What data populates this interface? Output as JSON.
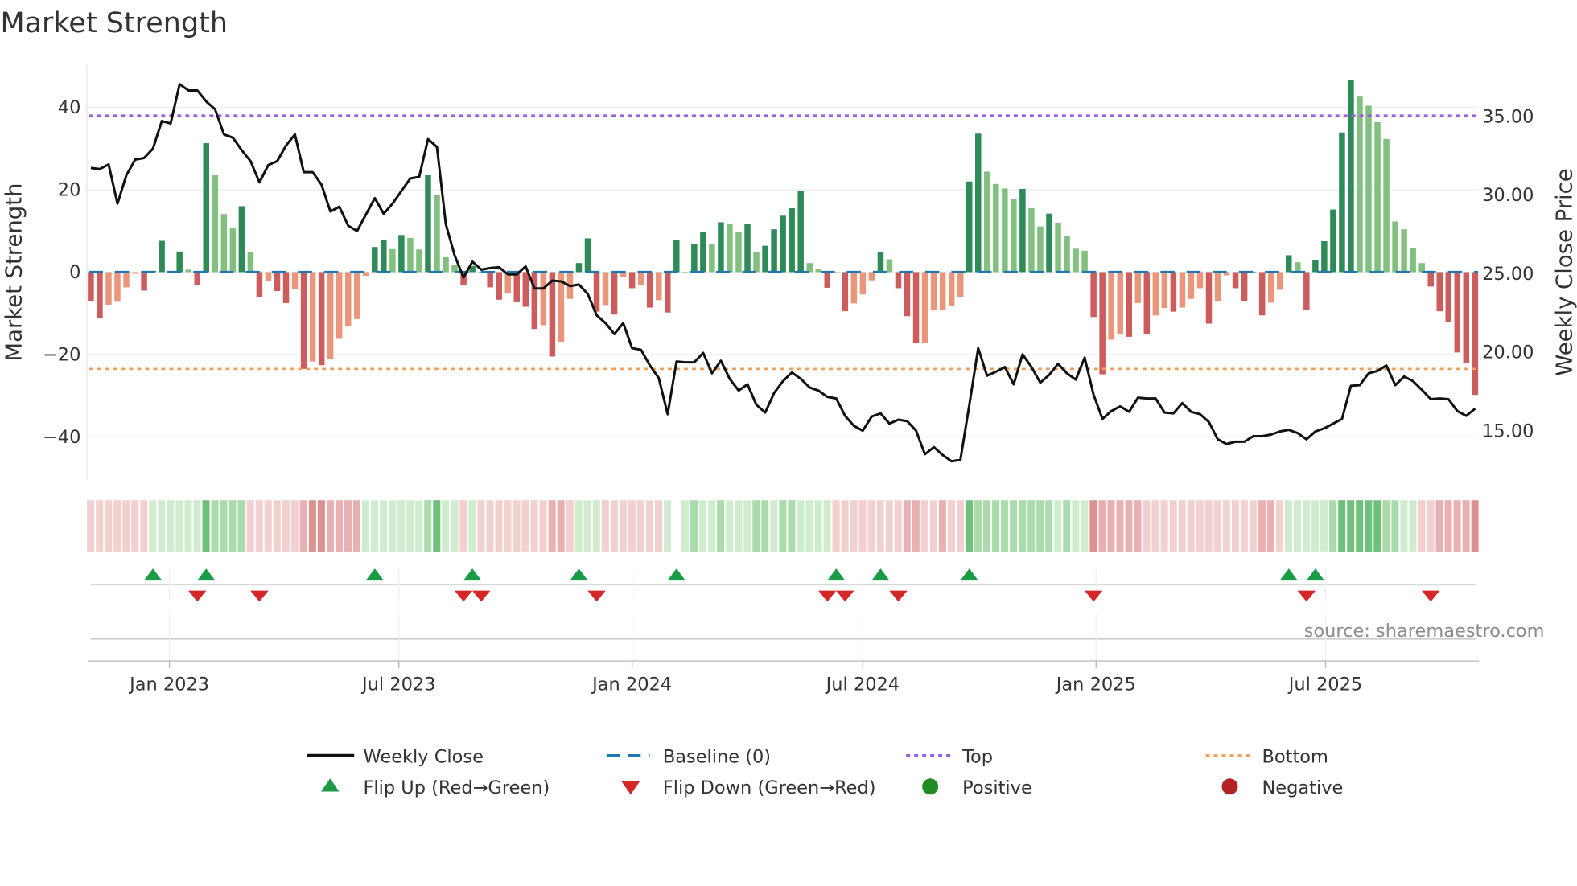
{
  "title": "Market Strength",
  "source": "source: sharemaestro.com",
  "colors": {
    "pos_strong": "#2e8b57",
    "pos_weak": "#81c07f",
    "neg_strong": "#cd5c5c",
    "neg_weak": "#e9967a",
    "close": "#111111",
    "baseline": "#1f77b4",
    "top": "#9c5de0",
    "bottom": "#f0a05a",
    "flip_up": "#1a9c46",
    "flip_down": "#d62728",
    "positive": "#228b22",
    "negative": "#b22222",
    "strip_green": [
      "#cfeccf",
      "#a9dcaa",
      "#6fc07a"
    ],
    "strip_red": [
      "#f2d0d0",
      "#e8b0b0",
      "#dc9090"
    ]
  },
  "legend": {
    "weekly_close": "Weekly Close",
    "baseline": "Baseline (0)",
    "top": "Top",
    "bottom": "Bottom",
    "flip_up": "Flip Up (Red→Green)",
    "flip_down": "Flip Down (Green→Red)",
    "positive": "Positive",
    "negative": "Negative"
  },
  "chart_data": {
    "type": "bar",
    "title": "Market Strength",
    "ylabel": "Market Strength",
    "y2label": "Weekly Close Price",
    "start_week": "2022-10-31",
    "ylim": [
      -50.5,
      50.2
    ],
    "y2lim": [
      11.8,
      38.2
    ],
    "yticks": [
      {
        "v": 40,
        "label": "40"
      },
      {
        "v": 20,
        "label": "20"
      },
      {
        "v": 0,
        "label": "0"
      },
      {
        "v": -20,
        "label": "−20"
      },
      {
        "v": -40,
        "label": "−40"
      }
    ],
    "y2ticks": [
      {
        "v": 35,
        "label": "35.00"
      },
      {
        "v": 30,
        "label": "30.00"
      },
      {
        "v": 25,
        "label": "25.00"
      },
      {
        "v": 20,
        "label": "20.00"
      },
      {
        "v": 15,
        "label": "15.00"
      }
    ],
    "xticks": [
      {
        "date": "2023-01-01",
        "label": "Jan 2023"
      },
      {
        "date": "2023-07-01",
        "label": "Jul 2023"
      },
      {
        "date": "2024-01-01",
        "label": "Jan 2024"
      },
      {
        "date": "2024-07-01",
        "label": "Jul 2024"
      },
      {
        "date": "2025-01-01",
        "label": "Jan 2025"
      },
      {
        "date": "2025-07-01",
        "label": "Jul 2025"
      }
    ],
    "top_level": 38,
    "bottom_level": -23.5,
    "baseline": 0,
    "strength": [
      -7.0,
      -11.1,
      -7.9,
      -7.2,
      -3.7,
      -0.4,
      -4.5,
      0.3,
      7.6,
      0.2,
      5.0,
      0.6,
      -3.2,
      31.3,
      23.5,
      14.1,
      10.6,
      16.0,
      4.9,
      -6.0,
      -2.1,
      -4.6,
      -7.5,
      -4.2,
      -23.5,
      -21.7,
      -22.6,
      -21.0,
      -16.2,
      -13.1,
      -11.4,
      -0.9,
      6.1,
      7.7,
      5.6,
      9.0,
      8.3,
      5.5,
      23.5,
      18.8,
      3.6,
      1.7,
      -3.1,
      1.5,
      0.1,
      -3.7,
      -6.7,
      -5.2,
      -7.3,
      -8.4,
      -13.8,
      -12.9,
      -20.5,
      -16.9,
      -6.5,
      2.2,
      8.2,
      -9.6,
      -8.0,
      -10.3,
      -1.3,
      -3.9,
      -3.2,
      -8.6,
      -6.8,
      -9.8,
      7.9,
      0.1,
      6.8,
      9.8,
      6.7,
      12.1,
      11.6,
      9.7,
      11.6,
      4.9,
      6.4,
      10.4,
      13.7,
      15.5,
      19.7,
      2.2,
      0.8,
      -3.8,
      -0.1,
      -9.5,
      -7.6,
      -5.4,
      -2.0,
      4.9,
      3.1,
      -3.9,
      -10.7,
      -17.1,
      -17.1,
      -9.3,
      -9.3,
      -8.2,
      -6.0,
      22.0,
      33.6,
      24.4,
      21.4,
      20.3,
      17.7,
      20.2,
      15.5,
      11.1,
      14.2,
      12.0,
      8.8,
      5.7,
      5.2,
      -10.9,
      -24.8,
      -16.4,
      -15.0,
      -15.7,
      -7.5,
      -15.1,
      -10.5,
      -8.7,
      -9.6,
      -8.6,
      -6.5,
      -3.9,
      -12.5,
      -7.0,
      -0.8,
      -3.9,
      -7.0,
      0,
      -10.5,
      -7.4,
      -4.3,
      4.1,
      2.4,
      -9.1,
      2.9,
      7.5,
      15.2,
      33.9,
      46.7,
      42.6,
      40.4,
      36.4,
      32.3,
      12.3,
      10.4,
      5.9,
      2.2,
      -3.5,
      -9.5,
      -12.1,
      -19.5,
      -22.0,
      -29.8
    ],
    "close": [
      31.67,
      31.6,
      31.9,
      29.4,
      31.2,
      32.2,
      32.3,
      32.9,
      34.65,
      34.5,
      37.0,
      36.6,
      36.6,
      35.9,
      35.4,
      33.8,
      33.6,
      32.8,
      32.1,
      30.75,
      31.85,
      32.1,
      33.1,
      33.8,
      31.4,
      31.4,
      30.6,
      28.9,
      29.2,
      28.0,
      27.65,
      28.7,
      29.75,
      28.75,
      29.4,
      30.2,
      31.0,
      31.1,
      33.5,
      33.0,
      28.1,
      26.1,
      24.7,
      25.7,
      25.2,
      25.3,
      25.35,
      24.9,
      24.9,
      25.4,
      24.0,
      24.0,
      24.5,
      24.45,
      24.15,
      24.25,
      23.65,
      22.3,
      21.8,
      21.1,
      21.8,
      20.2,
      20.1,
      19.1,
      18.3,
      16.0,
      19.35,
      19.3,
      19.3,
      19.9,
      18.6,
      19.4,
      18.25,
      17.5,
      17.9,
      16.6,
      16.1,
      17.35,
      18.1,
      18.65,
      18.25,
      17.7,
      17.5,
      17.1,
      17.0,
      15.9,
      15.25,
      14.95,
      15.85,
      16.05,
      15.4,
      15.65,
      15.55,
      14.95,
      13.45,
      13.9,
      13.4,
      13.0,
      13.1,
      16.6,
      20.2,
      18.45,
      18.7,
      19.0,
      17.9,
      19.8,
      19.0,
      18.0,
      18.5,
      19.2,
      18.6,
      18.2,
      19.6,
      17.25,
      15.7,
      16.2,
      16.5,
      16.15,
      17.05,
      17.0,
      17.0,
      16.1,
      16.05,
      16.7,
      16.15,
      16.0,
      15.5,
      14.4,
      14.1,
      14.25,
      14.25,
      14.6,
      14.6,
      14.7,
      14.9,
      15.0,
      14.8,
      14.4,
      14.9,
      15.1,
      15.4,
      15.7,
      17.8,
      17.85,
      18.6,
      18.75,
      19.1,
      17.85,
      18.4,
      18.1,
      17.55,
      16.95,
      17.0,
      16.95,
      16.2,
      15.9,
      16.35
    ],
    "regime_strip": [
      -1,
      -1,
      -1,
      -1,
      -1,
      -1,
      -1,
      1,
      1,
      1,
      1,
      1,
      1,
      3,
      2,
      2,
      2,
      2,
      -1,
      -1,
      -1,
      -1,
      -1,
      -1,
      -2,
      -3,
      -3,
      -2,
      -2,
      -2,
      -2,
      1,
      1,
      1,
      1,
      1,
      1,
      1,
      2,
      3,
      1,
      1,
      -1,
      1,
      -1,
      -1,
      -1,
      -1,
      -1,
      -1,
      -1,
      -1,
      -2,
      -2,
      -1,
      1,
      1,
      1,
      -1,
      -1,
      -1,
      -1,
      -1,
      -1,
      -1,
      1,
      0,
      1,
      2,
      1,
      1,
      2,
      1,
      1,
      1,
      2,
      2,
      1,
      2,
      2,
      1,
      1,
      1,
      1,
      -1,
      -1,
      -1,
      -1,
      -1,
      -1,
      -1,
      -1,
      -2,
      -2,
      -1,
      -1,
      -2,
      -1,
      -1,
      3,
      2,
      2,
      2,
      2,
      2,
      2,
      2,
      2,
      2,
      1,
      2,
      1,
      1,
      -3,
      -2,
      -2,
      -2,
      -2,
      -2,
      -1,
      -1,
      -1,
      -1,
      -1,
      -1,
      -1,
      -1,
      -1,
      -1,
      -1,
      -1,
      -1,
      -2,
      -2,
      -1,
      1,
      1,
      1,
      1,
      1,
      2,
      3,
      3,
      3,
      3,
      3,
      2,
      2,
      1,
      1,
      -1,
      -1,
      -2,
      -2,
      -2,
      -2,
      -3
    ],
    "flip_up_weeks": [
      7,
      13,
      32,
      43,
      55,
      66,
      84,
      89,
      99,
      135,
      138
    ],
    "flip_down_weeks": [
      12,
      19,
      42,
      44,
      57,
      83,
      85,
      91,
      113,
      137,
      151
    ]
  }
}
